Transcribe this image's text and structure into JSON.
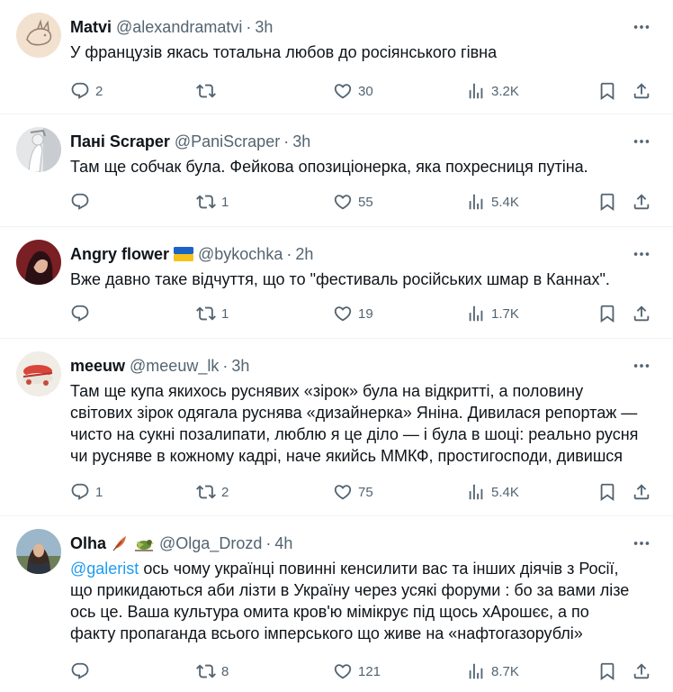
{
  "tweets": [
    {
      "name": "Matvi",
      "handle": "@alexandramatvi",
      "time": "3h",
      "text": "У французів якась тотальна любов до росіянського гівна",
      "replies": "2",
      "retweets": "",
      "likes": "30",
      "views": "3.2K"
    },
    {
      "name": "Пані Scraper",
      "handle": "@PaniScraper",
      "time": "3h",
      "text": "Там ще собчак була. Фейкова опозиціонерка, яка похресниця путіна.",
      "replies": "",
      "retweets": "1",
      "likes": "55",
      "views": "5.4K"
    },
    {
      "name": "Angry flower",
      "handle": "@bykochka",
      "time": "2h",
      "text": "Вже давно таке відчуття, що то \"фестиваль російських шмар в Каннах\".",
      "replies": "",
      "retweets": "1",
      "likes": "19",
      "views": "1.7K",
      "badge_icon": "ukraine-flag-icon"
    },
    {
      "name": "meeuw",
      "handle": "@meeuw_lk",
      "time": "3h",
      "text_lines": [
        "Там ще купа якихось руснявих «зірок» була на відкритті, а половину",
        "світових зірок одягала руснява «дизайнерка» Яніна. Дивилася репортаж —",
        "чисто на сукні позалипати, люблю я це діло — і була в шоці: реально русня",
        "чи русняве в кожному кадрі, наче якийсь ММКФ, простигосподи, дивишся"
      ],
      "replies": "1",
      "retweets": "2",
      "likes": "75",
      "views": "5.4K"
    },
    {
      "name": "Olha",
      "handle": "@Olga_Drozd",
      "time": "4h",
      "mention": "@galerist",
      "text_lines": [
        " ось чому українці повинні кенсилити вас та інших діячів з Росії,",
        "що прикидаються аби лізти в Україну через усякі форуми : бо за вами лізе",
        "ось це. Ваша культура омита кров'ю мімікрує  під щось хАрошєє, а по",
        "факту пропаганда всього імперського що живе на «нафтогазорублі»"
      ],
      "replies": "",
      "retweets": "8",
      "likes": "121",
      "views": "8.7K",
      "badge_icons": [
        "feather-icon",
        "bird-icon"
      ]
    }
  ],
  "colors": {
    "text": "#0f1419",
    "secondary": "#536471",
    "link": "#1d9bf0",
    "divider": "#eff3f4"
  }
}
